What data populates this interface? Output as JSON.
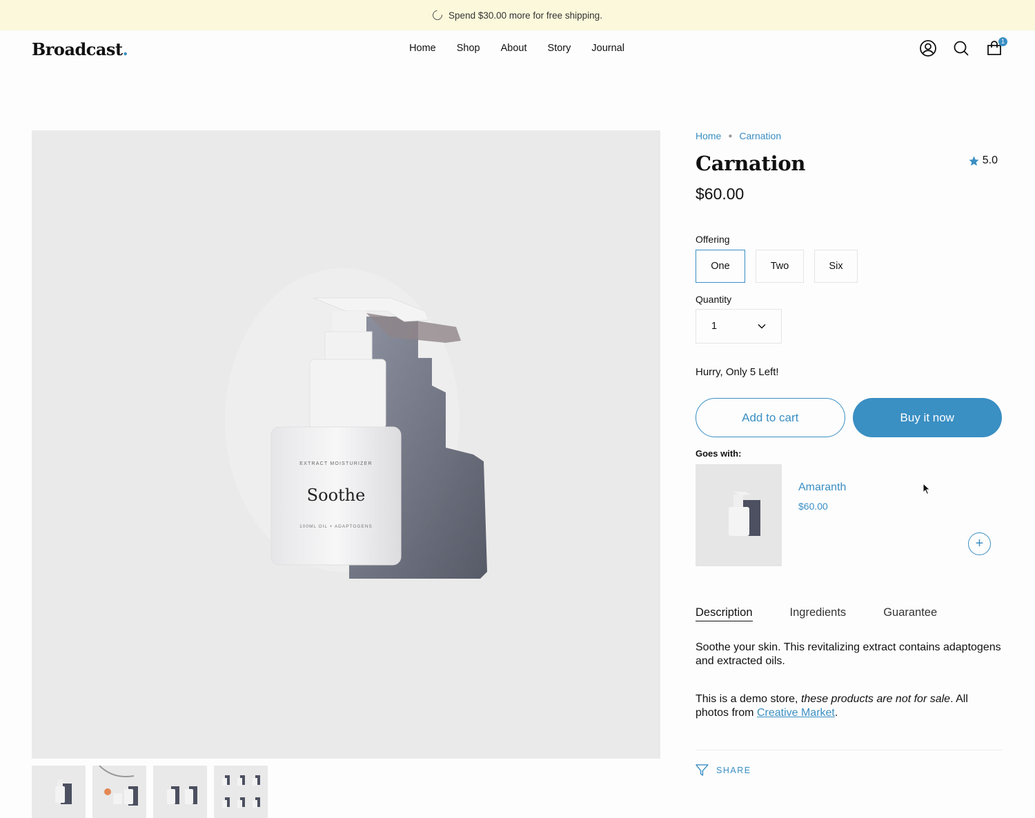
{
  "announcement": {
    "text": "Spend $30.00 more for free shipping."
  },
  "header": {
    "logo": "Broadcast",
    "logo_dot": ".",
    "nav": [
      "Home",
      "Shop",
      "About",
      "Story",
      "Journal"
    ],
    "icons": [
      "account-icon",
      "search-icon",
      "cart-icon"
    ],
    "cart_count": "1"
  },
  "product": {
    "image_label_small_top": "EXTRACT MOISTURIZER",
    "image_label_main": "Soothe",
    "image_label_small_bottom": "100ML OIL + ADAPTOGENS",
    "breadcrumbs": [
      "Home",
      "Carnation"
    ],
    "title": "Carnation",
    "rating": "5.0",
    "price": "$60.00",
    "offering_label": "Offering",
    "offerings": [
      "One",
      "Two",
      "Six"
    ],
    "selected_offering": "One",
    "quantity_label": "Quantity",
    "quantity": "1",
    "stock_message": "Hurry, Only 5 Left!",
    "add_to_cart": "Add to cart",
    "buy_now": "Buy it now"
  },
  "goes_with": {
    "label": "Goes with:",
    "name": "Amaranth",
    "price": "$60.00",
    "add_symbol": "+"
  },
  "tabs": [
    "Description",
    "Ingredients",
    "Guarantee"
  ],
  "description": {
    "p1": "Soothe your skin.  This revitalizing extract contains adaptogens and extracted oils.",
    "p2_start": "This is a demo store, ",
    "p2_italic": "these products are not for sale",
    "p2_mid": ". All photos from ",
    "p2_link": "Creative Market",
    "p2_end": "."
  },
  "share": {
    "label": "SHARE"
  },
  "colors": {
    "accent": "#3a8fc3",
    "announce_bg": "#fbf8db",
    "image_bg": "#eaeaea"
  }
}
